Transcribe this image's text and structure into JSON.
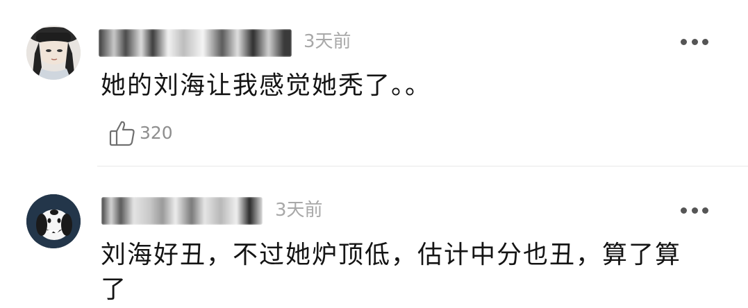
{
  "comments": [
    {
      "avatar_icon": "avatar-anime-man-with-hat-icon",
      "username": "",
      "time": "3天前",
      "text": "她的刘海让我感觉她秃了。。",
      "likes": "320",
      "like_icon": "thumbs-up-icon",
      "more_icon": "more-options-icon"
    },
    {
      "avatar_icon": "avatar-snoopy-dog-icon",
      "username": "",
      "time": "3天前",
      "text_line1": "刘海好丑，不过她炉顶低，估计中分也丑，算了算",
      "text_line2": "了",
      "more_icon": "more-options-icon"
    }
  ]
}
